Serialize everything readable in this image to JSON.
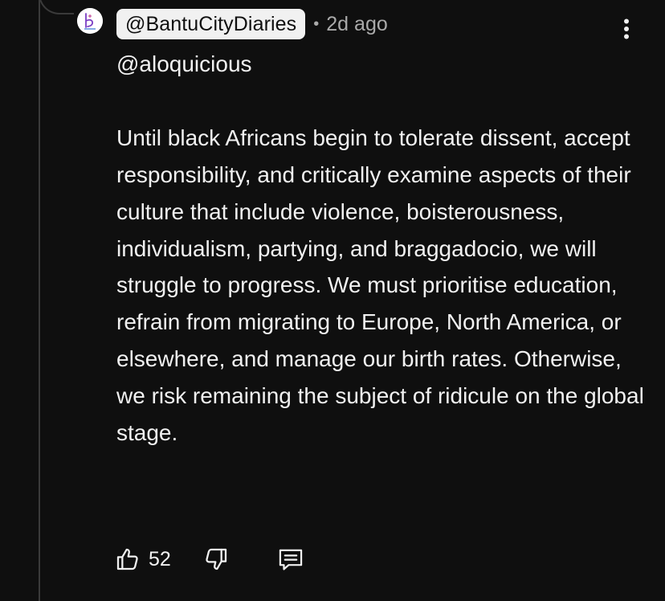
{
  "comment": {
    "author": "@BantuCityDiaries",
    "separator": "•",
    "time": "2d ago",
    "mention": "@aloquicious",
    "body": "Until black Africans begin to tolerate dissent, accept responsibility, and critically examine aspects of their culture that include violence, boisterousness, individualism, partying, and braggadocio, we will struggle to progress. We must prioritise education, refrain from migrating to Europe, North America, or elsewhere, and manage our birth rates. Otherwise, we risk remaining the subject of ridicule on the global stage.",
    "likes": "52"
  },
  "icons": {
    "menu": "more-vertical-icon",
    "like": "thumbs-up-icon",
    "dislike": "thumbs-down-icon",
    "reply": "comment-reply-icon"
  },
  "colors": {
    "background": "#0f0f0f",
    "text": "#f1f1f1",
    "secondary_text": "#aaaaaa",
    "author_chip_bg": "#f1f1f1",
    "thread_line": "#3a3a3a"
  }
}
